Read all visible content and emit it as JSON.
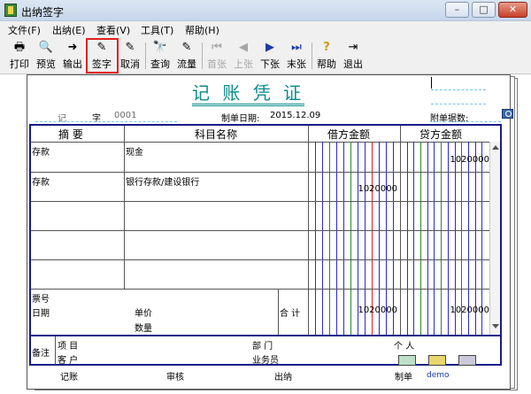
{
  "window": {
    "title": "出纳签字",
    "min": "–",
    "max": "□",
    "close": "✕"
  },
  "menu": [
    "文件(F)",
    "出纳(E)",
    "查看(V)",
    "工具(T)",
    "帮助(H)"
  ],
  "toolbar": [
    {
      "label": "打印",
      "icon": "🖶",
      "enabled": true
    },
    {
      "label": "预览",
      "icon": "🔍",
      "enabled": true
    },
    {
      "label": "输出",
      "icon": "➜",
      "enabled": true
    },
    {
      "label": "签字",
      "icon": "✎",
      "enabled": true
    },
    {
      "label": "取消",
      "icon": "✎",
      "enabled": true
    },
    {
      "label": "查询",
      "icon": "🔭",
      "enabled": true
    },
    {
      "label": "流量",
      "icon": "✎",
      "enabled": true
    },
    {
      "label": "首张",
      "icon": "⏮",
      "enabled": false
    },
    {
      "label": "上张",
      "icon": "◀",
      "enabled": false
    },
    {
      "label": "下张",
      "icon": "▶",
      "enabled": true
    },
    {
      "label": "末张",
      "icon": "⏭",
      "enabled": true
    },
    {
      "label": "帮助",
      "icon": "?",
      "enabled": true
    },
    {
      "label": "退出",
      "icon": "⇥",
      "enabled": true
    }
  ],
  "voucher": {
    "title": "记 账 凭 证",
    "ji": "记",
    "zi": "字",
    "number": "0001",
    "date_label": "制单日期:",
    "date": "2015.12.09",
    "attach_label": "附单据数:",
    "headers": {
      "summary": "摘 要",
      "account": "科目名称",
      "debit": "借方金额",
      "credit": "贷方金额"
    },
    "rows": [
      {
        "summary": "存款",
        "account": "现金",
        "debit": "",
        "credit": "1020000"
      },
      {
        "summary": "存款",
        "account": "银行存款/建设银行",
        "debit": "1020000",
        "credit": ""
      }
    ],
    "ticket": "票号",
    "date_small": "日期",
    "price": "单价",
    "qty": "数量",
    "total_label": "合 计",
    "total_debit": "1020000",
    "total_credit": "1020000",
    "remark": "备注",
    "project": "项 目",
    "customer": "客 户",
    "dept": "部 门",
    "staff": "业务员",
    "person": "个 人"
  },
  "footer": {
    "bookkeep": "记账",
    "review": "审核",
    "cashier": "出纳",
    "maker": "制单",
    "maker_name": "demo"
  },
  "colors": {
    "title": "#0a8a8a",
    "border": "#1a1a8a",
    "blue_line": "#2a2acc",
    "red_line": "#e02020",
    "highlight": "#e02020"
  }
}
